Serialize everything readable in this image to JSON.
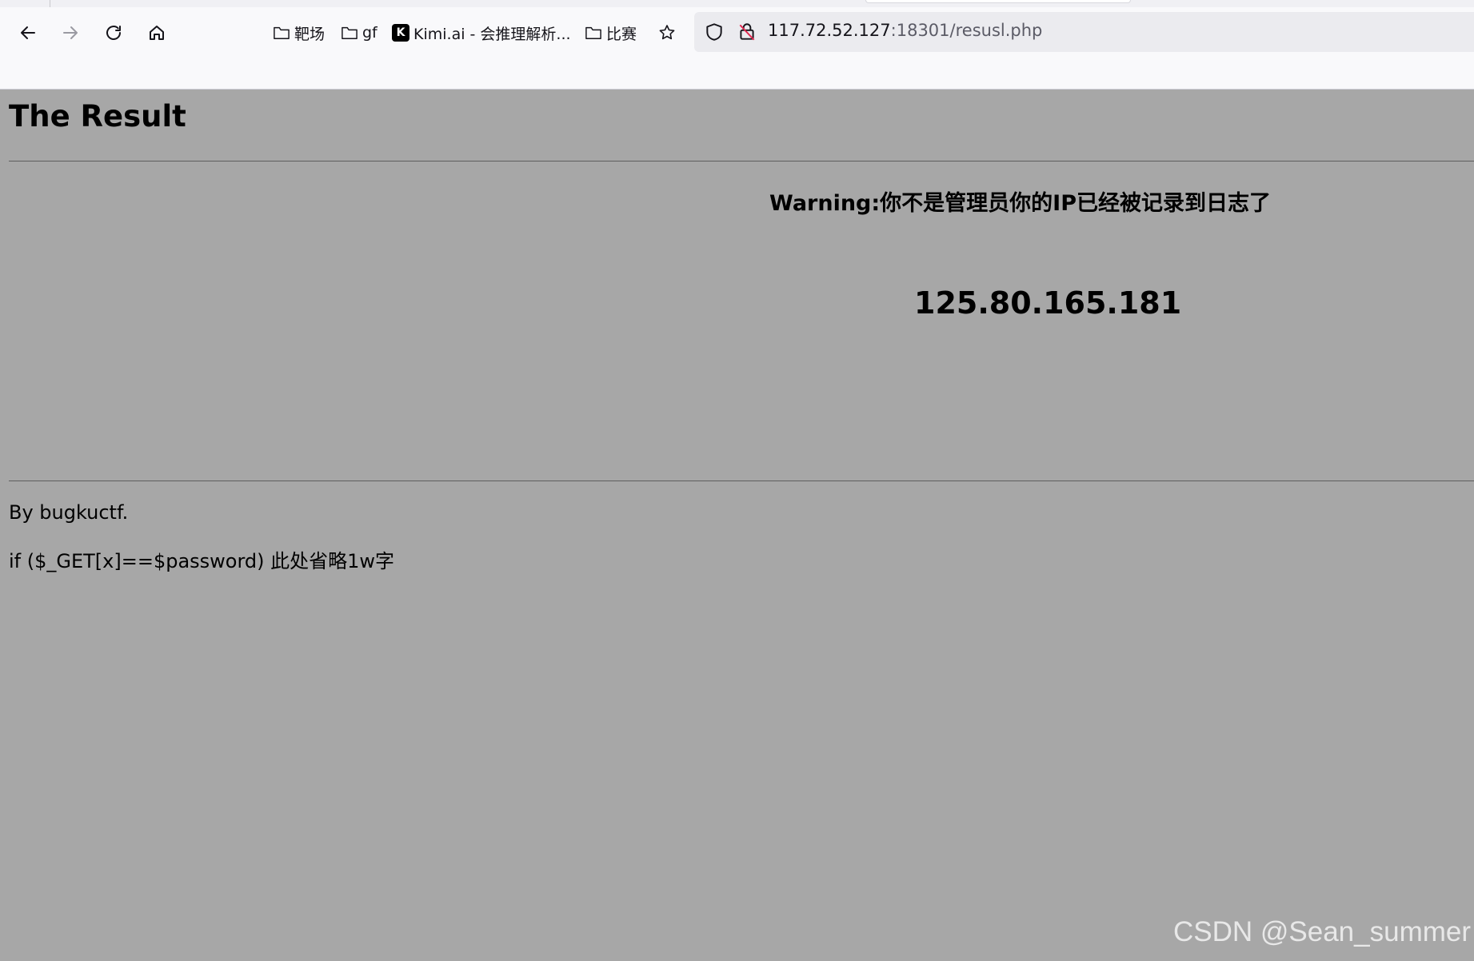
{
  "browser": {
    "bookmarks": [
      {
        "label": "靶场",
        "icon": "folder-icon"
      },
      {
        "label": "gf",
        "icon": "folder-icon"
      },
      {
        "label": "Kimi.ai - 会推理解析...",
        "icon": "kimi-logo-icon"
      },
      {
        "label": "比赛",
        "icon": "folder-icon"
      }
    ],
    "url_host": "117.72.52.127",
    "url_rest": ":18301/resusl.php"
  },
  "page": {
    "title": "The Result",
    "warning": "Warning:你不是管理员你的IP已经被记录到日志了",
    "ip": "125.80.165.181",
    "author": "By bugkuctf.",
    "code_line": "if ($_GET[x]==$password) 此处省略1w字"
  },
  "watermark": "CSDN @Sean_summer",
  "colors": {
    "page_background": "#a7a7a7",
    "chrome_background": "#f9f9fb",
    "urlbar_background": "#ebebef"
  }
}
